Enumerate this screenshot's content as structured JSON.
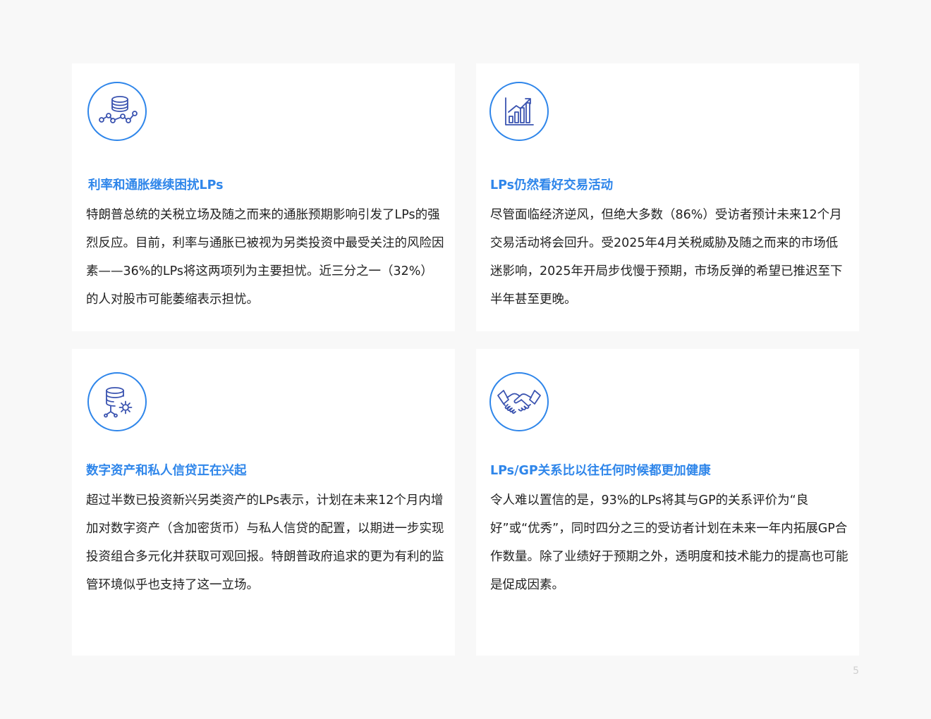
{
  "colors": {
    "accent": "#2f86ea",
    "icon_stroke": "#3a53b0",
    "body_text": "#222222",
    "background": "#f8f8f8",
    "card": "#ffffff"
  },
  "cards": [
    {
      "icon": "database-network-icon",
      "title": "利率和通胀继续困扰LPs",
      "body": "特朗普总统的关税立场及随之而来的通胀预期影响引发了LPs的强烈反应。目前，利率与通胀已被视为另类投资中最受关注的风险因素——36%的LPs将这两项列为主要担忧。近三分之一（32%）的人对股市可能萎缩表示担忧。"
    },
    {
      "icon": "growth-chart-icon",
      "title": "LPs仍然看好交易活动",
      "body": "尽管面临经济逆风，但绝大多数（86%）受访者预计未来12个月交易活动将会回升。受2025年4月关税威胁及随之而来的市场低迷影响，2025年开局步伐慢于预期，市场反弹的希望已推迟至下半年甚至更晚。"
    },
    {
      "icon": "database-gear-icon",
      "title": "数字资产和私人信贷正在兴起",
      "body": "超过半数已投资新兴另类资产的LPs表示，计划在未来12个月内增加对数字资产（含加密货币）与私人信贷的配置，以期进一步实现投资组合多元化并获取可观回报。特朗普政府追求的更为有利的监管环境似乎也支持了这一立场。"
    },
    {
      "icon": "handshake-icon",
      "title": "LPs/GP关系比以往任何时候都更加健康",
      "body": "令人难以置信的是，93%的LPs将其与GP的关系评价为“良好”或“优秀”，同时四分之三的受访者计划在未来一年内拓展GP合作数量。除了业绩好于预期之外，透明度和技术能力的提高也可能是促成因素。"
    }
  ],
  "page_number": "5"
}
